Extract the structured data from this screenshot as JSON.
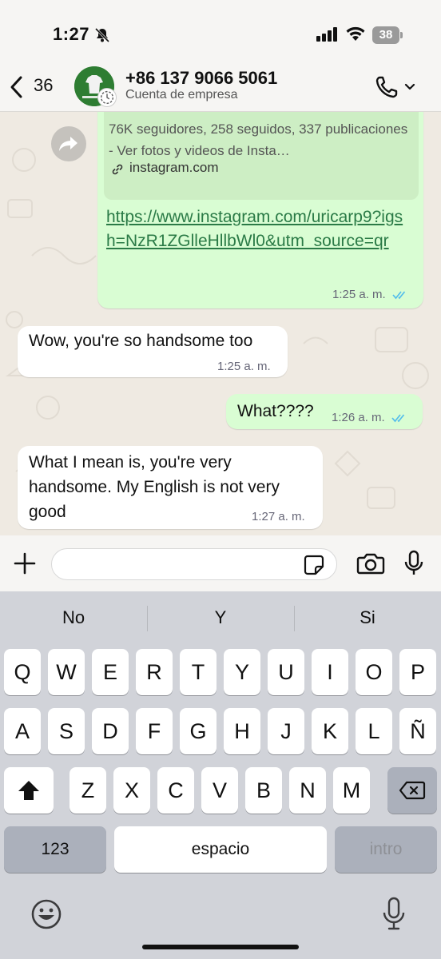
{
  "status_bar": {
    "time": "1:27",
    "battery": "38",
    "icons": [
      "bell-slash-icon",
      "cellular-signal-icon",
      "wifi-icon",
      "battery-icon"
    ]
  },
  "header": {
    "back_count": "36",
    "contact_name": "+86 137 9066 5061",
    "subtitle": "Cuenta de empresa",
    "icons": [
      "chevron-left-icon",
      "phone-icon",
      "chevron-down-icon"
    ]
  },
  "messages": [
    {
      "type": "link",
      "direction": "outgoing",
      "preview_desc": "76K seguidores, 258 seguidos, 337 publicaciones - Ver fotos y videos de Insta…",
      "preview_domain": "instagram.com",
      "link": "https://www.instagram.com/uricarp9?igsh=NzR1ZGlleHllbWl0&utm_source=qr",
      "time": "1:25 a. m.",
      "read": true
    },
    {
      "type": "text",
      "direction": "incoming",
      "text": "Wow, you're so handsome too",
      "time": "1:25 a. m."
    },
    {
      "type": "text",
      "direction": "outgoing",
      "text": "What????",
      "time": "1:26 a. m.",
      "read": true
    },
    {
      "type": "text",
      "direction": "incoming",
      "text": "What I mean is, you're very handsome. My English is not very good",
      "time": "1:27 a. m."
    }
  ],
  "composer": {
    "placeholder": "",
    "icons": [
      "plus-icon",
      "sticker-icon",
      "camera-icon",
      "microphone-icon"
    ]
  },
  "keyboard": {
    "suggestions": [
      "No",
      "Y",
      "Si"
    ],
    "row1": [
      "Q",
      "W",
      "E",
      "R",
      "T",
      "Y",
      "U",
      "I",
      "O",
      "P"
    ],
    "row2": [
      "A",
      "S",
      "D",
      "F",
      "G",
      "H",
      "J",
      "K",
      "L",
      "Ñ"
    ],
    "row3": [
      "Z",
      "X",
      "C",
      "V",
      "B",
      "N",
      "M"
    ],
    "numbers_key": "123",
    "space_key": "espacio",
    "return_key": "intro",
    "icons": [
      "shift-icon",
      "delete-icon",
      "emoji-icon",
      "dictation-mic-icon"
    ]
  },
  "colors": {
    "outgoing_bubble": "#d9fdd3",
    "incoming_bubble": "#ffffff",
    "link": "#2a7a46",
    "read_ticks": "#53bdeb",
    "chat_background": "#efeae2",
    "keyboard_background": "#d1d3d9"
  }
}
